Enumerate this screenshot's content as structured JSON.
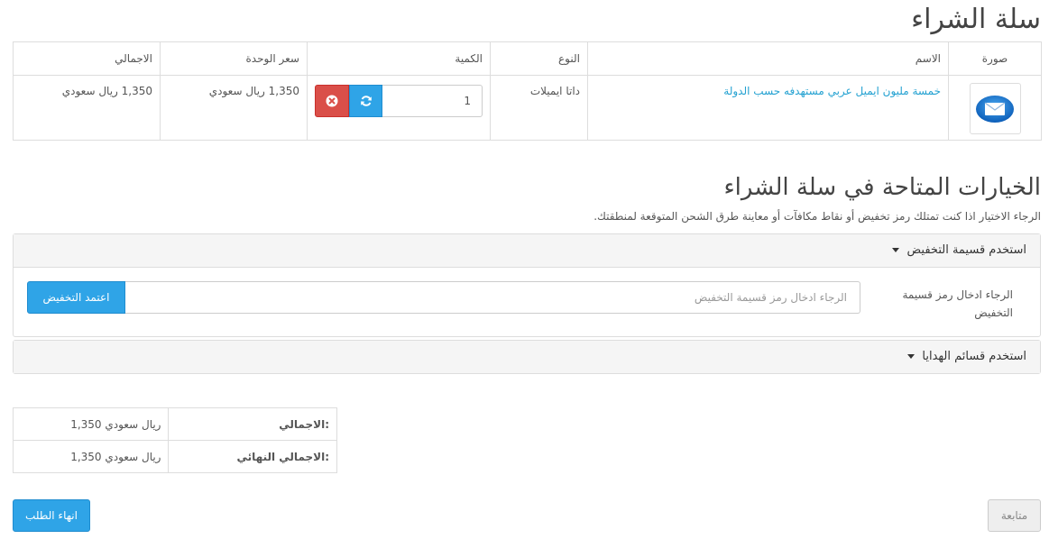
{
  "page": {
    "title": "سلة الشراء"
  },
  "cart_table": {
    "headers": {
      "image": "صورة",
      "name": "الاسم",
      "type": "النوع",
      "quantity": "الكمية",
      "unit_price": "سعر الوحدة",
      "total": "الاجمالي"
    },
    "rows": [
      {
        "image_icon": "envelope-icon",
        "name": "خمسة مليون ايميل عربي مستهدفه حسب الدولة",
        "type": "داتا ايميلات",
        "quantity": "1",
        "unit_price": "1,350 ريال سعودي",
        "total": "1,350 ريال سعودي"
      }
    ]
  },
  "options": {
    "title": "الخيارات المتاحة في سلة الشراء",
    "hint": "الرجاء الاختيار اذا كنت تمتلك رمز تخفيض أو نقاط مكافآت أو معاينة طرق الشحن المتوقعة لمنطقتك.",
    "coupon_panel": {
      "heading": "استخدم قسيمة التخفيض",
      "label": "الرجاء ادخال رمز قسيمة التخفيض",
      "placeholder": "الرجاء ادخال رمز قسيمة التخفيض",
      "apply_button": "اعتمد التخفيض"
    },
    "voucher_panel": {
      "heading": "استخدم قسائم الهدايا"
    }
  },
  "totals": [
    {
      "label": "الاجمالي:",
      "value": "1,350 ريال سعودي"
    },
    {
      "label": "الاجمالي النهائي:",
      "value": "1,350 ريال سعودي"
    }
  ],
  "actions": {
    "checkout": "انهاء الطلب",
    "continue": "متابعة"
  },
  "colors": {
    "primary": "#2fa4e7",
    "danger": "#da4f49",
    "link": "#23a1d1"
  }
}
